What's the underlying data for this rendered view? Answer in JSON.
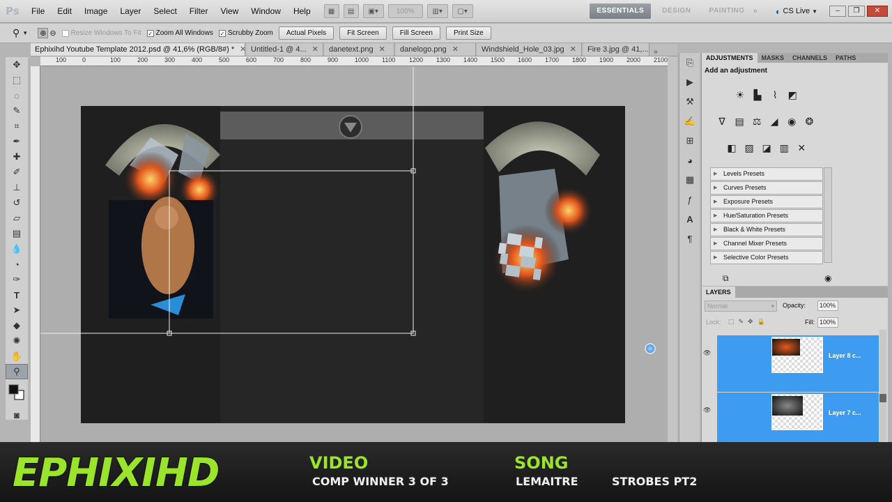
{
  "app": {
    "logo": "Ps"
  },
  "menu": [
    "File",
    "Edit",
    "Image",
    "Layer",
    "Select",
    "Filter",
    "View",
    "Window",
    "Help"
  ],
  "menubar_extra": {
    "zoom_display": "100%"
  },
  "workspaces": [
    "ESSENTIALS",
    "DESIGN",
    "PAINTING"
  ],
  "cs_live": "CS Live",
  "options": {
    "resize_windows": "Resize Windows To Fit",
    "zoom_all": "Zoom All Windows",
    "scrubby": "Scrubby Zoom",
    "actual_pixels": "Actual Pixels",
    "fit_screen": "Fit Screen",
    "fill_screen": "Fill Screen",
    "print_size": "Print Size"
  },
  "tabs": [
    "Ephixihd Youtube Template 2012.psd @ 41,6% (RGB/8#) *",
    "Untitled-1 @ 4...",
    "danetext.png",
    "danelogo.png",
    "Windshield_Hole_03.jpg",
    "Fire 3.jpg @ 41,..."
  ],
  "ruler": [
    "100",
    "0",
    "100",
    "200",
    "300",
    "400",
    "500",
    "600",
    "700",
    "800",
    "900",
    "1000",
    "1100",
    "1200",
    "1300",
    "1400",
    "1500",
    "1600",
    "1700",
    "1800",
    "1900",
    "2000",
    "2100"
  ],
  "adjustments": {
    "tabs": [
      "ADJUSTMENTS",
      "MASKS",
      "CHANNELS",
      "PATHS"
    ],
    "heading": "Add an adjustment",
    "presets": [
      "Levels Presets",
      "Curves Presets",
      "Exposure Presets",
      "Hue/Saturation Presets",
      "Black & White Presets",
      "Channel Mixer Presets",
      "Selective Color Presets"
    ]
  },
  "layers": {
    "title": "LAYERS",
    "blend": "Normal",
    "opacity_label": "Opacity:",
    "opacity": "100%",
    "lock_label": "Lock:",
    "fill_label": "Fill:",
    "fill": "100%",
    "items": [
      "Layer 8 c...",
      "Layer 7 c..."
    ]
  },
  "banner": {
    "brand": "EPHIXIHD",
    "video_head": "VIDEO",
    "video_text": "COMP WINNER 3 OF 3",
    "song_head": "SONG",
    "song_artist": "LEMAITRE",
    "song_title": "STROBES PT2"
  }
}
